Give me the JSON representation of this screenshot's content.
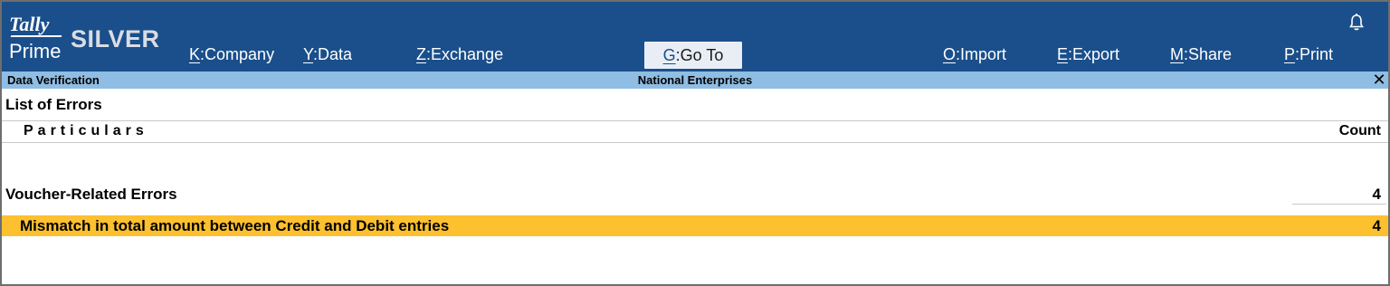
{
  "app": {
    "logo_top": "Tally",
    "logo_bottom": "Prime",
    "edition": "SILVER"
  },
  "menu": [
    {
      "key": "K",
      "label": "Company"
    },
    {
      "key": "Y",
      "label": "Data"
    },
    {
      "key": "Z",
      "label": "Exchange"
    },
    {
      "key": "G",
      "label": "Go To"
    },
    {
      "key": "O",
      "label": "Import"
    },
    {
      "key": "E",
      "label": "Export"
    },
    {
      "key": "M",
      "label": "Share"
    },
    {
      "key": "P",
      "label": "Print"
    }
  ],
  "subheader": {
    "screen": "Data Verification",
    "company": "National Enterprises",
    "close_glyph": "✕"
  },
  "report": {
    "title": "List of Errors",
    "col_particulars": "Particulars",
    "col_count": "Count",
    "groups": [
      {
        "name": "Voucher-Related Errors",
        "count": "4",
        "items": [
          {
            "name": "Mismatch in total amount between Credit and Debit entries",
            "count": "4"
          }
        ]
      }
    ]
  },
  "colors": {
    "topbar": "#1a4f8b",
    "subbar": "#8fbde3",
    "highlight": "#fdc02f"
  },
  "icons": {
    "notification": "bell-icon",
    "close": "close-icon"
  }
}
